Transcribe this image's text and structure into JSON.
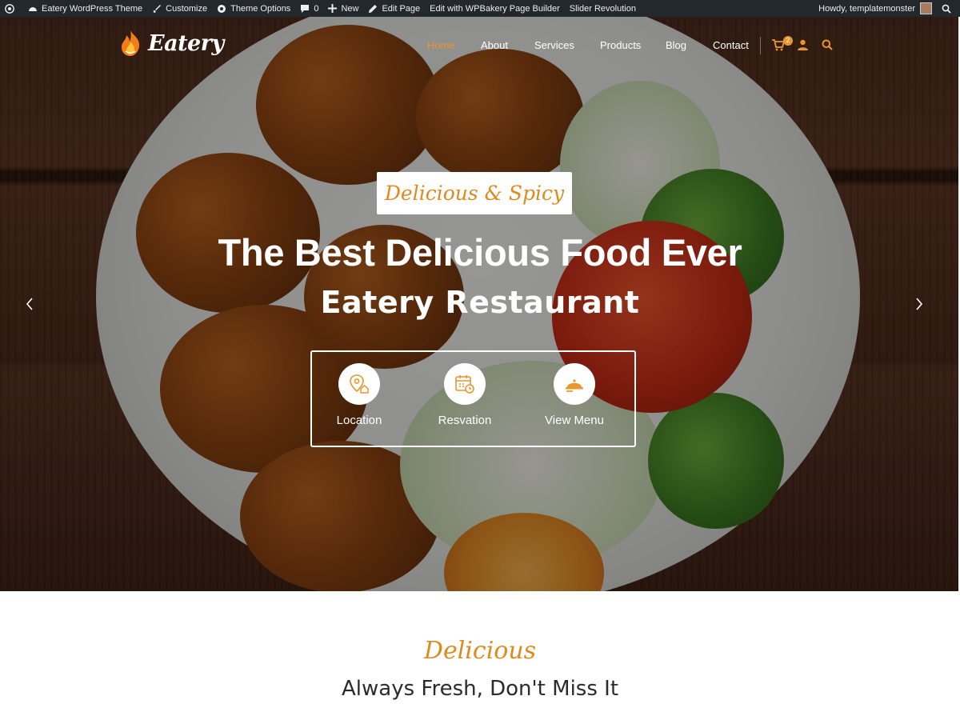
{
  "admin_bar": {
    "site_name": "Eatery WordPress Theme",
    "customize": "Customize",
    "theme_options": "Theme Options",
    "comments_count": "0",
    "new": "New",
    "edit_page": "Edit Page",
    "wpbakery": "Edit with WPBakery Page Builder",
    "slider": "Slider Revolution",
    "howdy": "Howdy, templatemonster"
  },
  "header": {
    "logo_text": "Eatery",
    "nav": [
      "Home",
      "About",
      "Services",
      "Products",
      "Blog",
      "Contact"
    ],
    "active_nav": "Home",
    "cart_count": "2"
  },
  "hero": {
    "tagline": "Delicious & Spicy",
    "headline": "The Best Delicious Food Ever",
    "subheadline": "Eatery Restaurant",
    "features": [
      {
        "label": "Location",
        "icon": "location-pin-icon"
      },
      {
        "label": "Resvation",
        "icon": "calendar-clock-icon"
      },
      {
        "label": "View Menu",
        "icon": "serving-dish-icon"
      }
    ],
    "prev_icon": "chevron-left-icon",
    "next_icon": "chevron-right-icon"
  },
  "section": {
    "kicker": "Delicious",
    "title": "Always Fresh, Don't Miss It"
  },
  "colors": {
    "accent": "#e9962c",
    "admin_bar": "#23282d",
    "title_text": "#2b2b2b"
  }
}
